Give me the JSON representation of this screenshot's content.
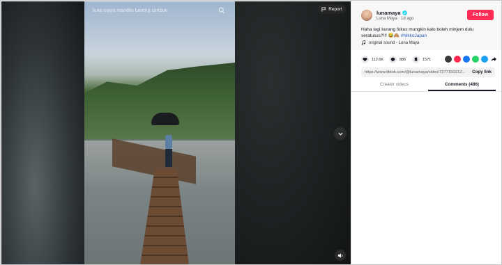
{
  "video": {
    "search_text": "luna maya mandiin bareng cirebon",
    "report_label": "Report"
  },
  "author": {
    "username": "lunamaya",
    "subline": "Luna Maya · 1d ago",
    "follow_label": "Follow"
  },
  "caption": {
    "text": "Haha lagi kurang fokus mungkin kalo boleh minjem dulu seratusss?!!! 😂🙈 ",
    "hashtag": "#NikkoJapan"
  },
  "sound": {
    "label": "original sound - Luna Maya"
  },
  "actions": {
    "likes": "112.6K",
    "comments": "886",
    "saves": "1571"
  },
  "link": {
    "url": "https://www.tiktok.com/@lunamaya/video/7277150212...",
    "copy_label": "Copy link"
  },
  "tabs": {
    "creator_videos": "Creator videos",
    "comments": "Comments (486)"
  },
  "colors": {
    "follow": "#fe2c55",
    "hashtag": "#2b5db9"
  }
}
